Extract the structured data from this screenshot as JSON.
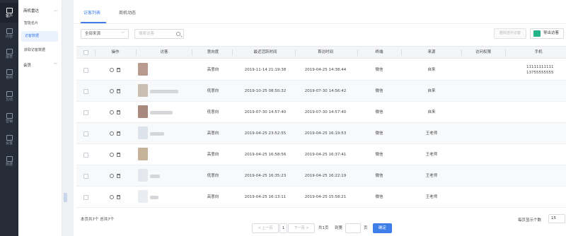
{
  "rail": [
    {
      "icon": "customer-icon",
      "label": "客户"
    },
    {
      "icon": "document-icon",
      "label": "内容"
    },
    {
      "icon": "report-icon",
      "label": "报表"
    },
    {
      "icon": "monitor-icon",
      "label": "官网"
    },
    {
      "icon": "chat-icon",
      "label": "互动"
    },
    {
      "icon": "tag-icon",
      "label": "营销"
    },
    {
      "icon": "settings-icon",
      "label": "设置"
    },
    {
      "icon": "data-icon",
      "label": "数据"
    }
  ],
  "submenu": {
    "group1": "商机雷达",
    "items": [
      "智能名片",
      "访客数据",
      "获取访客数据"
    ],
    "group2": "会员"
  },
  "tabs": [
    "访客列表",
    "商机动态"
  ],
  "filters": {
    "source_select": "全部来源",
    "search_placeholder": "搜索访客"
  },
  "actions": {
    "delete": "删除选中访客",
    "export": "导出访客"
  },
  "table": {
    "headers": [
      "操作",
      "访客",
      "意向度",
      "最近活跃时间",
      "首访时间",
      "终端",
      "来源",
      "访问权限",
      "手机"
    ],
    "rows": [
      {
        "intent": "高意向",
        "last_active": "2019-11-14 21:19:38",
        "first_visit": "2019-04-25 14:38:44",
        "terminal": "微信",
        "source": "自来",
        "permission": "",
        "phone": [
          "11111111111",
          "13755555555"
        ]
      },
      {
        "intent": "低意向",
        "last_active": "2019-10-25 08:50:32",
        "first_visit": "2019-07-30 14:56:42",
        "terminal": "微信",
        "source": "自来",
        "permission": "",
        "phone": []
      },
      {
        "intent": "低意向",
        "last_active": "2019-07-30 14:57:40",
        "first_visit": "2019-07-30 14:57:40",
        "terminal": "微信",
        "source": "自来",
        "permission": "",
        "phone": []
      },
      {
        "intent": "高意向",
        "last_active": "2019-04-25 23:52:55",
        "first_visit": "2019-04-25 16:19:53",
        "terminal": "微信",
        "source": "王老师",
        "permission": "",
        "phone": []
      },
      {
        "intent": "高意向",
        "last_active": "2019-04-25 16:58:56",
        "first_visit": "2019-04-25 16:37:41",
        "terminal": "微信",
        "source": "王老师",
        "permission": "",
        "phone": []
      },
      {
        "intent": "低意向",
        "last_active": "2019-04-25 16:35:23",
        "first_visit": "2019-04-25 16:22:19",
        "terminal": "微信",
        "source": "王老师",
        "permission": "",
        "phone": []
      },
      {
        "intent": "高意向",
        "last_active": "2019-04-25 16:13:11",
        "first_visit": "2019-04-25 15:58:21",
        "terminal": "微信",
        "source": "王老师",
        "permission": "",
        "phone": []
      }
    ]
  },
  "footer": {
    "count_text": "本页共7个  总共7个",
    "prev": "< 上一页",
    "page": "1",
    "next": "下一页 >",
    "total_pages": "共1页",
    "goto": "到第",
    "page_unit": "页",
    "confirm": "确定",
    "per_page_label": "每页显示个数",
    "per_page_value": "15"
  }
}
